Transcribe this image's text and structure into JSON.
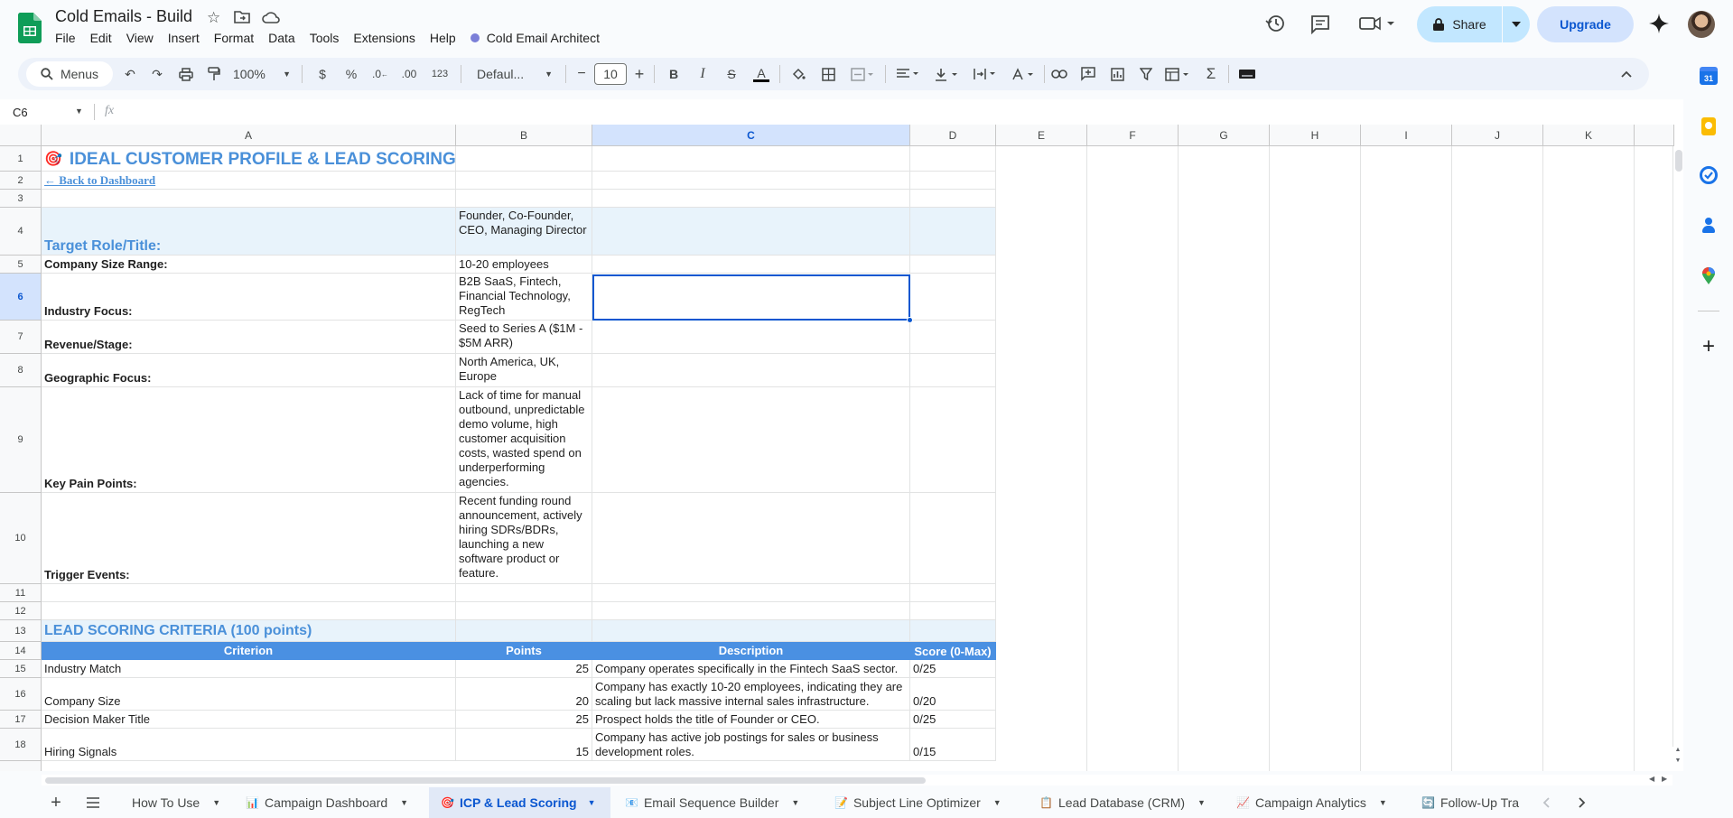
{
  "app": {
    "title": "Cold Emails - Build",
    "menu": [
      "File",
      "Edit",
      "View",
      "Insert",
      "Format",
      "Data",
      "Tools",
      "Extensions",
      "Help"
    ],
    "extension_menu": "Cold Email Architect",
    "share_label": "Share",
    "upgrade_label": "Upgrade"
  },
  "toolbar": {
    "menus_label": "Menus",
    "zoom": "100%",
    "currency": "$",
    "percent": "%",
    "dec_decrease": ".0←",
    "dec_increase": ".00",
    "number_format": "123",
    "font": "Defaul...",
    "font_size": "10",
    "minus": "−",
    "plus": "+",
    "bold": "B",
    "italic": "I",
    "strike": "S",
    "text_color": "A"
  },
  "formula": {
    "cell_ref": "C6",
    "fx": "fx",
    "content": ""
  },
  "columns": [
    "A",
    "B",
    "C",
    "D",
    "E",
    "F",
    "G",
    "H",
    "I",
    "J",
    "K"
  ],
  "rows": [
    "1",
    "2",
    "3",
    "4",
    "5",
    "6",
    "7",
    "8",
    "9",
    "10",
    "11",
    "12",
    "13",
    "14",
    "15",
    "16",
    "17",
    "18"
  ],
  "sheet": {
    "title_emoji": "🎯",
    "title": "IDEAL CUSTOMER PROFILE & LEAD SCORING",
    "back_link": "← Back to Dashboard",
    "profile": [
      {
        "label": "Target Role/Title:",
        "value": "Founder, Co-Founder, CEO, Managing Director"
      },
      {
        "label": "Company Size Range:",
        "value": "10-20 employees"
      },
      {
        "label": "Industry Focus:",
        "value": "B2B SaaS, Fintech, Financial Technology, RegTech"
      },
      {
        "label": "Revenue/Stage:",
        "value": "Seed to Series A ($1M - $5M ARR)"
      },
      {
        "label": "Geographic Focus:",
        "value": "North America, UK, Europe"
      },
      {
        "label": "Key Pain Points:",
        "value": "Lack of time for manual outbound, unpredictable demo volume, high customer acquisition costs, wasted spend on underperforming agencies."
      },
      {
        "label": "Trigger Events:",
        "value": "Recent funding round announcement, actively hiring SDRs/BDRs, launching a new software product or feature."
      }
    ],
    "scoring_title": "LEAD SCORING CRITERIA (100 points)",
    "headers": [
      "Criterion",
      "Points",
      "Description",
      "Score (0-Max)"
    ],
    "criteria": [
      {
        "criterion": "Industry Match",
        "points": "25",
        "description": "Company operates specifically in the Fintech SaaS sector.",
        "score": "0/25"
      },
      {
        "criterion": "Company Size",
        "points": "20",
        "description": "Company has exactly 10-20 employees, indicating they are scaling but lack massive internal sales infrastructure.",
        "score": "0/20"
      },
      {
        "criterion": "Decision Maker Title",
        "points": "25",
        "description": "Prospect holds the title of Founder or CEO.",
        "score": "0/25"
      },
      {
        "criterion": "Hiring Signals",
        "points": "15",
        "description": "Company has active job postings for sales or business development roles.",
        "score": "0/15"
      }
    ]
  },
  "tabs": [
    {
      "label": "How To Use"
    },
    {
      "label": "Campaign Dashboard",
      "icon": "📊"
    },
    {
      "label": "ICP & Lead Scoring",
      "icon": "🎯"
    },
    {
      "label": "Email Sequence Builder",
      "icon": "📧"
    },
    {
      "label": "Subject Line Optimizer",
      "icon": "📝"
    },
    {
      "label": "Lead Database (CRM)",
      "icon": "📋"
    },
    {
      "label": "Campaign Analytics",
      "icon": "📈"
    },
    {
      "label": "Follow-Up Tra",
      "icon": "🔄"
    }
  ],
  "colors": {
    "accent": "#4a90d9",
    "header_fill": "#4a90e2",
    "light_fill": "#e8f3fb",
    "selection": "#0b57d0"
  }
}
